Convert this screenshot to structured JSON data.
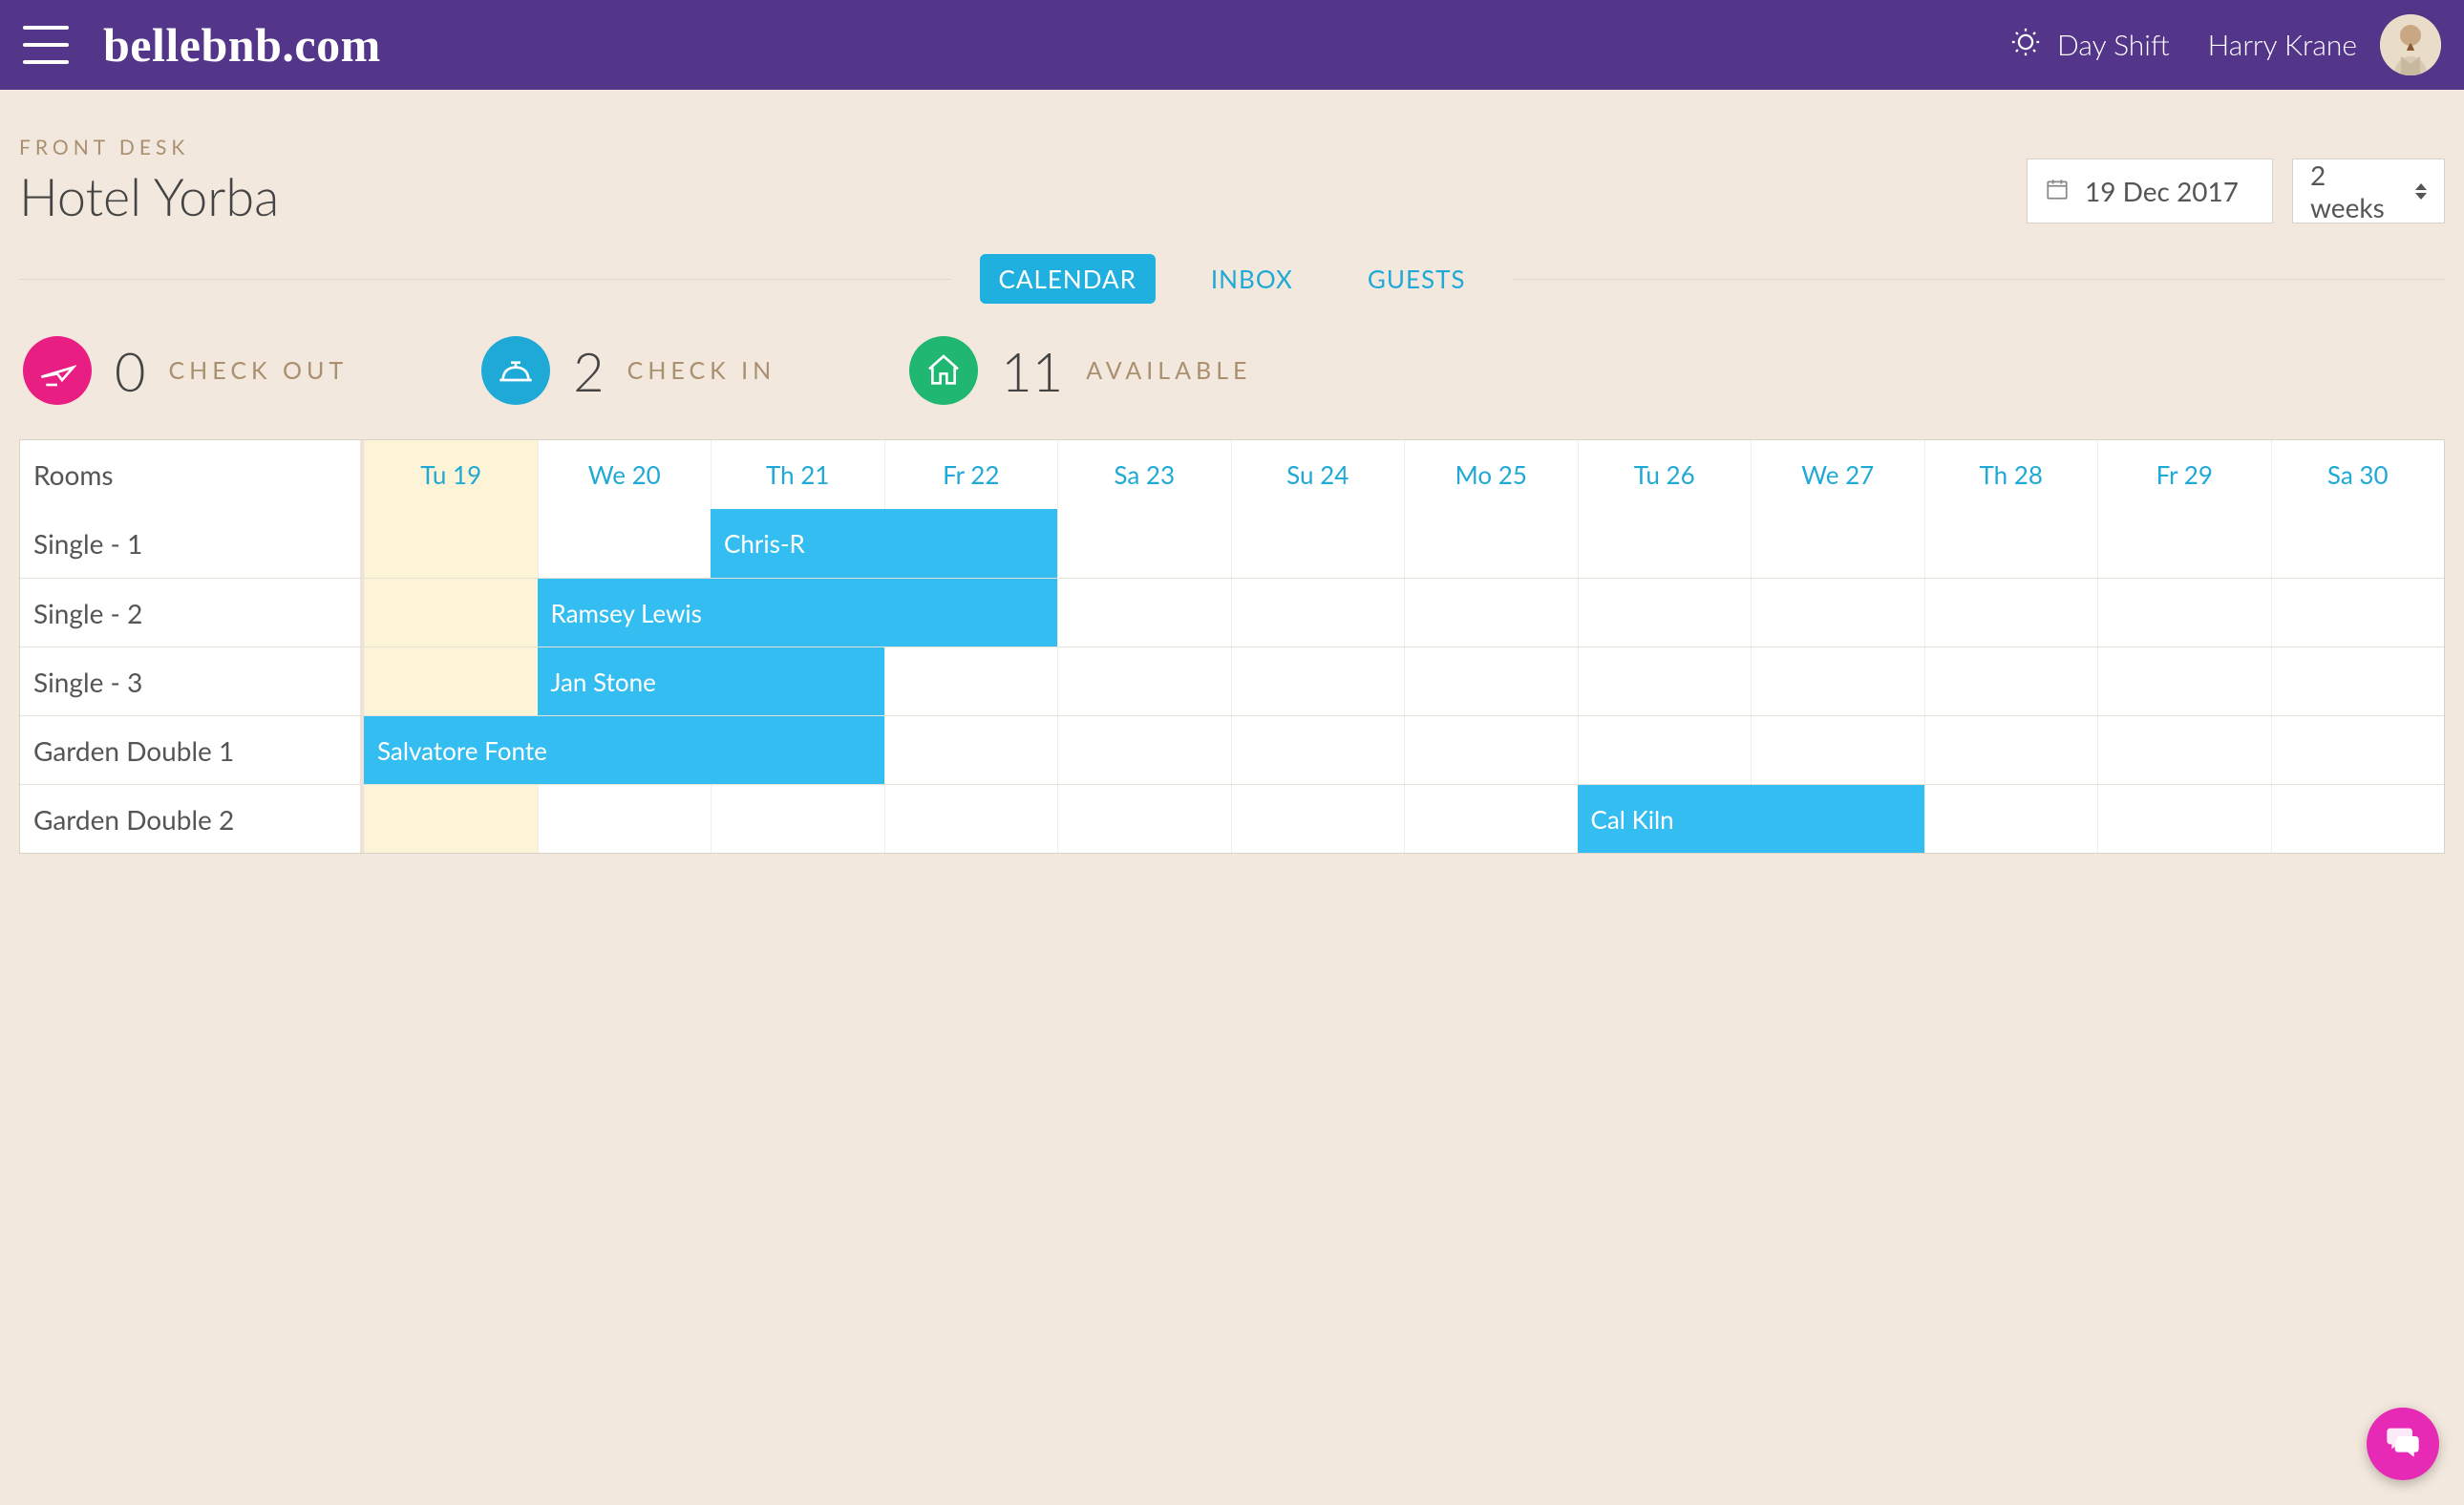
{
  "header": {
    "logo": "bellebnb.com",
    "shift_label": "Day Shift",
    "user_name": "Harry Krane"
  },
  "page": {
    "breadcrumb": "FRONT DESK",
    "title": "Hotel Yorba",
    "date_value": "19 Dec 2017",
    "range_value": "2 weeks"
  },
  "tabs": {
    "items": [
      "CALENDAR",
      "INBOX",
      "GUESTS"
    ],
    "active_index": 0
  },
  "stats": {
    "checkout": {
      "count": "0",
      "label": "CHECK OUT"
    },
    "checkin": {
      "count": "2",
      "label": "CHECK IN"
    },
    "available": {
      "count": "11",
      "label": "AVAILABLE"
    }
  },
  "calendar": {
    "rooms_header": "Rooms",
    "days": [
      "Tu 19",
      "We 20",
      "Th 21",
      "Fr 22",
      "Sa 23",
      "Su 24",
      "Mo 25",
      "Tu 26",
      "We 27",
      "Th 28",
      "Fr 29",
      "Sa 30"
    ],
    "today_index": 0,
    "rooms": [
      {
        "name": "Single - 1",
        "bookings": [
          {
            "guest": "Chris-R",
            "start": 2,
            "span": 2
          }
        ]
      },
      {
        "name": "Single - 2",
        "bookings": [
          {
            "guest": "Ramsey Lewis",
            "start": 1,
            "span": 3
          }
        ]
      },
      {
        "name": "Single - 3",
        "bookings": [
          {
            "guest": "Jan Stone",
            "start": 1,
            "span": 2
          }
        ]
      },
      {
        "name": "Garden Double 1",
        "bookings": [
          {
            "guest": "Salvatore Fonte",
            "start": 0,
            "span": 3
          }
        ]
      },
      {
        "name": "Garden Double 2",
        "bookings": [
          {
            "guest": "Cal Kiln",
            "start": 7,
            "span": 2
          }
        ]
      }
    ]
  }
}
